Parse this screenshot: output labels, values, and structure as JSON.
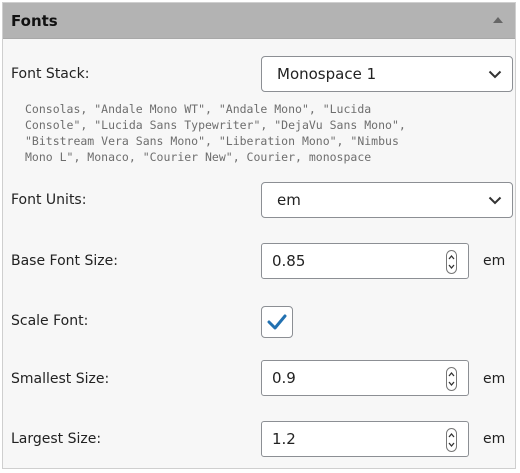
{
  "panel": {
    "title": "Fonts"
  },
  "font_stack": {
    "label": "Font Stack:",
    "selected": "Monospace 1",
    "preview": "Consolas, \"Andale Mono WT\", \"Andale Mono\", \"Lucida\nConsole\", \"Lucida Sans Typewriter\", \"DejaVu Sans Mono\",\n\"Bitstream Vera Sans Mono\", \"Liberation Mono\", \"Nimbus\nMono L\", Monaco, \"Courier New\", Courier, monospace"
  },
  "font_units": {
    "label": "Font Units:",
    "selected": "em"
  },
  "base_font_size": {
    "label": "Base Font Size:",
    "value": "0.85",
    "unit": "em"
  },
  "scale_font": {
    "label": "Scale Font:",
    "checked": true
  },
  "smallest_size": {
    "label": "Smallest Size:",
    "value": "0.9",
    "unit": "em"
  },
  "largest_size": {
    "label": "Largest Size:",
    "value": "1.2",
    "unit": "em"
  },
  "icons": {
    "collapse": "triangle-up-icon",
    "dropdown": "chevron-down-icon",
    "spinner": "spinner-arrows-icon",
    "check": "checkmark-icon"
  },
  "colors": {
    "header": "#b3b3b3",
    "check": "#2271b1",
    "panel": "#f7f7f7"
  }
}
